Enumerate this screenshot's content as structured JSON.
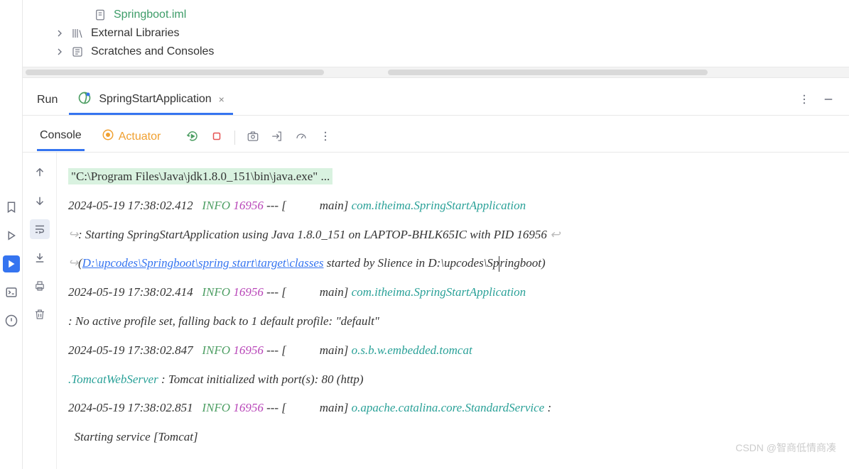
{
  "tree": {
    "file": "Springboot.iml",
    "external": "External Libraries",
    "scratches": "Scratches and Consoles"
  },
  "run": {
    "title": "Run",
    "tab_label": "SpringStartApplication"
  },
  "subtabs": {
    "console": "Console",
    "actuator": "Actuator"
  },
  "console": {
    "cmd": "\"C:\\Program Files\\Java\\jdk1.8.0_151\\bin\\java.exe\" ...",
    "lines": [
      {
        "ts": "2024-05-19 17:38:02.412",
        "level": "INFO",
        "pid": "16956",
        "sep": "--- [",
        "thread": "main]",
        "logger": "com.itheima.SpringStartApplication",
        "msg_pre": ": Starting SpringStartApplication using Java 1.8.0_151 on LAPTOP-BHLK65IC with PID 16956 ",
        "link": "D:\\upcodes\\Springboot\\spring start\\target\\classes",
        "msg_mid": " started by Slience in D:\\upcodes\\Sp",
        "msg_post": "ringboot)"
      },
      {
        "ts": "2024-05-19 17:38:02.414",
        "level": "INFO",
        "pid": "16956",
        "sep": "--- [",
        "thread": "main]",
        "logger": "com.itheima.SpringStartApplication",
        "msg": " : No active profile set, falling back to 1 default profile: \"default\""
      },
      {
        "ts": "2024-05-19 17:38:02.847",
        "level": "INFO",
        "pid": "16956",
        "sep": "--- [",
        "thread": "main]",
        "logger": "o.s.b.w.embedded.tomcat",
        "msg_pre": " .TomcatWebServer",
        "msg": "  : Tomcat initialized with port(s): 80 (http)"
      },
      {
        "ts": "2024-05-19 17:38:02.851",
        "level": "INFO",
        "pid": "16956",
        "sep": "--- [",
        "thread": "main]",
        "logger": "o.apache.catalina.core.StandardService",
        "msg_tail": "   :",
        "msg": "Starting service [Tomcat]"
      }
    ]
  },
  "watermark": "CSDN @智商低情商凑"
}
